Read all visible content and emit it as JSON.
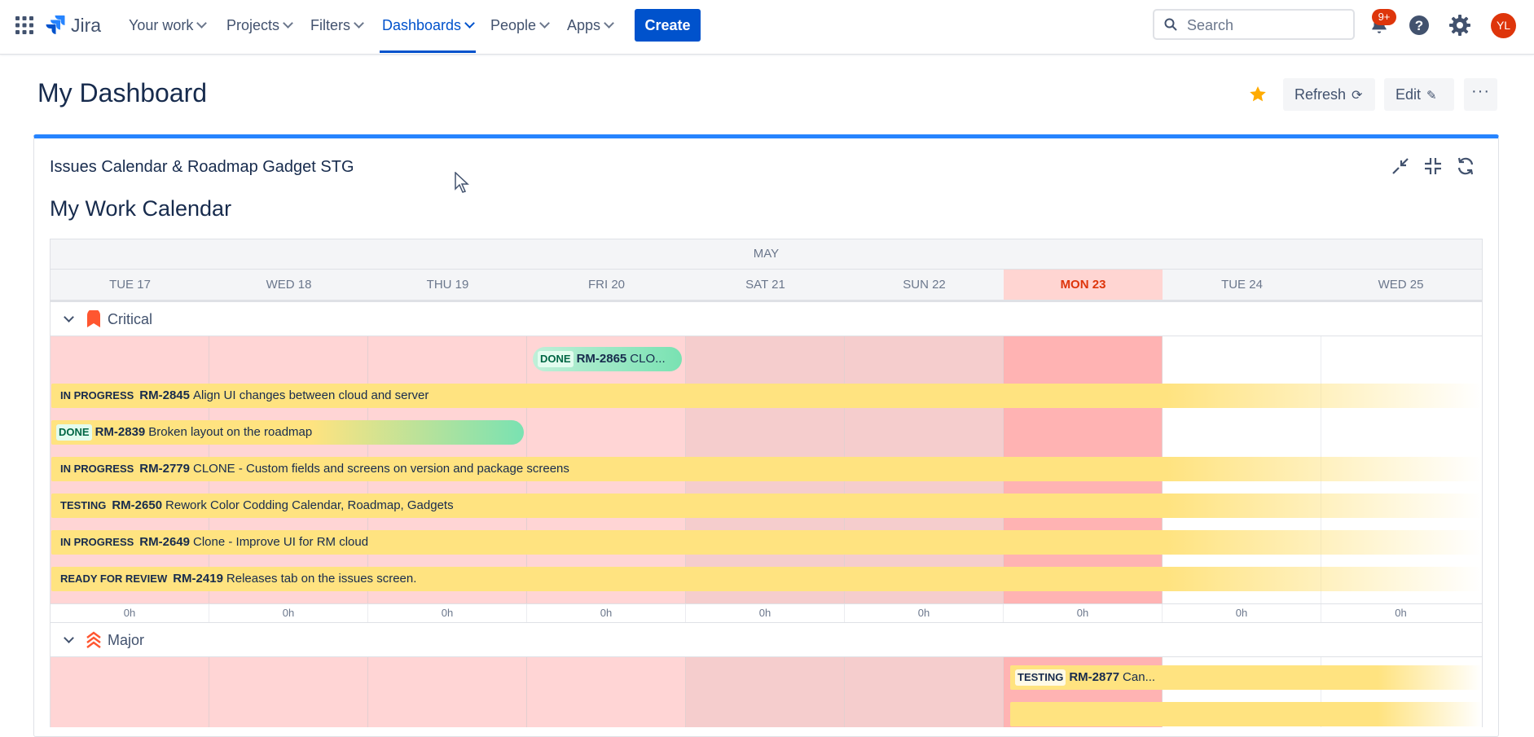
{
  "nav": {
    "items": [
      {
        "label": "Your work"
      },
      {
        "label": "Projects"
      },
      {
        "label": "Filters"
      },
      {
        "label": "Dashboards"
      },
      {
        "label": "People"
      },
      {
        "label": "Apps"
      }
    ],
    "logo_text": "Jira",
    "create_label": "Create",
    "search_placeholder": "Search",
    "notifications_badge": "9+",
    "avatar_initials": "YL",
    "accent_color": "#0052cc"
  },
  "header": {
    "title": "My Dashboard",
    "refresh_label": "Refresh",
    "edit_label": "Edit"
  },
  "gadget": {
    "title": "Issues Calendar & Roadmap Gadget STG",
    "calendar_title": "My Work Calendar",
    "month": "MAY",
    "days": [
      {
        "label": "TUE 17"
      },
      {
        "label": "WED 18"
      },
      {
        "label": "THU 19"
      },
      {
        "label": "FRI 20"
      },
      {
        "label": "SAT 21"
      },
      {
        "label": "SUN 22"
      },
      {
        "label": "MON 23"
      },
      {
        "label": "TUE 24"
      },
      {
        "label": "WED 25"
      }
    ],
    "hours": [
      "0h",
      "0h",
      "0h",
      "0h",
      "0h",
      "0h",
      "0h",
      "0h",
      "0h"
    ],
    "groups": [
      {
        "label": "Critical",
        "issues": [
          {
            "status": "DONE",
            "key": "RM-2865",
            "summary": "CLO..."
          },
          {
            "status": "IN PROGRESS",
            "key": "RM-2845",
            "summary": "Align UI changes between cloud and server"
          },
          {
            "status": "DONE",
            "key": "RM-2839",
            "summary": "Broken layout on the roadmap"
          },
          {
            "status": "IN PROGRESS",
            "key": "RM-2779",
            "summary": "CLONE - Custom fields and screens on version and package screens"
          },
          {
            "status": "TESTING",
            "key": "RM-2650",
            "summary": "Rework Color Codding Calendar, Roadmap, Gadgets"
          },
          {
            "status": "IN PROGRESS",
            "key": "RM-2649",
            "summary": "Clone - Improve UI for RM cloud"
          },
          {
            "status": "READY FOR REVIEW",
            "key": "RM-2419",
            "summary": "Releases tab on the issues screen."
          }
        ]
      },
      {
        "label": "Major",
        "issues": [
          {
            "status": "TESTING",
            "key": "RM-2877",
            "summary": "Can..."
          }
        ]
      }
    ],
    "colors": {
      "today_header": "#de350b",
      "weekday_bg": "#ffd5d5",
      "weekend_bg": "#f5cdcd",
      "today_bg": "#ffb3b3",
      "in_progress_bar": "#ffe380",
      "done_bar": "#79e2b2"
    }
  }
}
